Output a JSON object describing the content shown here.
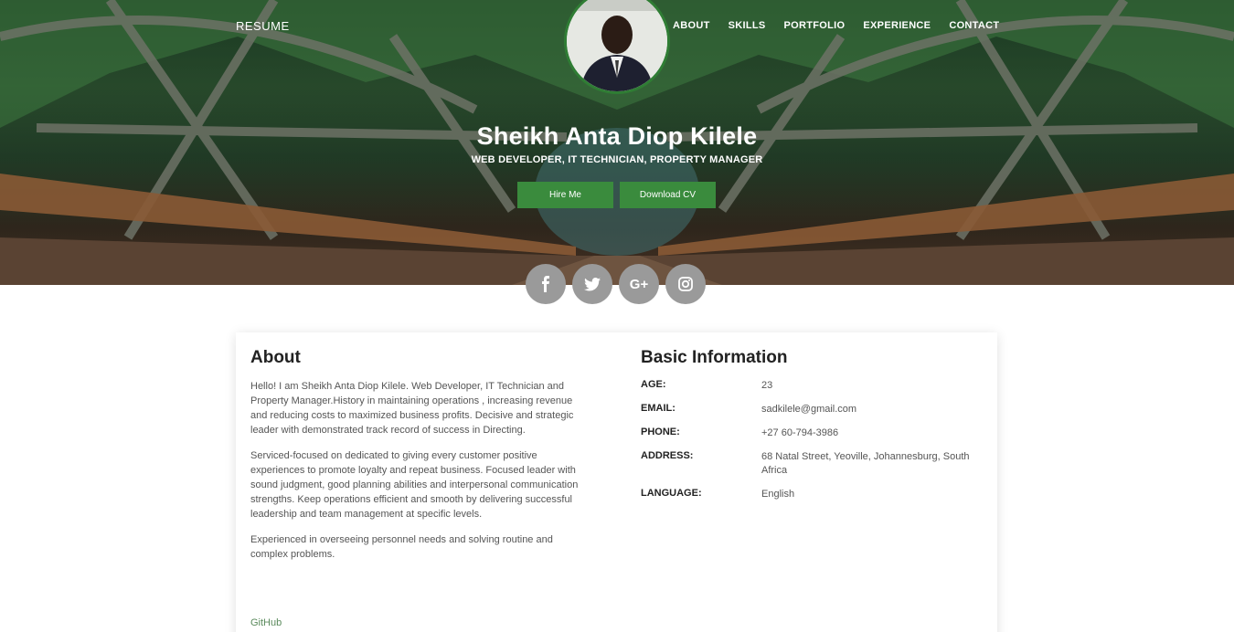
{
  "nav": {
    "brand": "RESUME",
    "links": [
      "ABOUT",
      "SKILLS",
      "PORTFOLIO",
      "EXPERIENCE",
      "CONTACT"
    ]
  },
  "hero": {
    "name": "Sheikh Anta Diop Kilele",
    "tagline": "WEB DEVELOPER, IT TECHNICIAN, PROPERTY MANAGER",
    "hire_label": "Hire Me",
    "cv_label": "Download CV"
  },
  "social": [
    {
      "icon": "facebook-icon",
      "glyph": "f"
    },
    {
      "icon": "twitter-icon",
      "glyph": "t"
    },
    {
      "icon": "google-plus-icon",
      "glyph": "G+"
    },
    {
      "icon": "instagram-icon",
      "glyph": ""
    }
  ],
  "about": {
    "title": "About",
    "paragraphs": [
      "Hello! I am Sheikh Anta Diop Kilele. Web Developer, IT Technician and Property Manager.History in maintaining operations , increasing revenue and reducing costs to maximized business profits. Decisive and strategic leader with demonstrated track record of success in Directing.",
      "Serviced-focused on dedicated to giving every customer positive experiences to promote loyalty and repeat business. Focused leader with sound judgment, good planning abilities and interpersonal communication strengths. Keep operations efficient and smooth by delivering successful leadership and team management at specific levels.",
      "Experienced in overseeing personnel needs and solving routine and complex problems."
    ],
    "github_label": "GitHub"
  },
  "basic": {
    "title": "Basic Information",
    "rows": [
      {
        "k": "AGE:",
        "v": "23"
      },
      {
        "k": "EMAIL:",
        "v": "sadkilele@gmail.com"
      },
      {
        "k": "PHONE:",
        "v": "+27 60-794-3986"
      },
      {
        "k": "ADDRESS:",
        "v": "68 Natal Street, Yeoville, Johannesburg, South Africa"
      },
      {
        "k": "LANGUAGE:",
        "v": "English"
      }
    ]
  },
  "colors": {
    "accent": "#3a8b3d",
    "social_bg": "#9a9a9a"
  }
}
